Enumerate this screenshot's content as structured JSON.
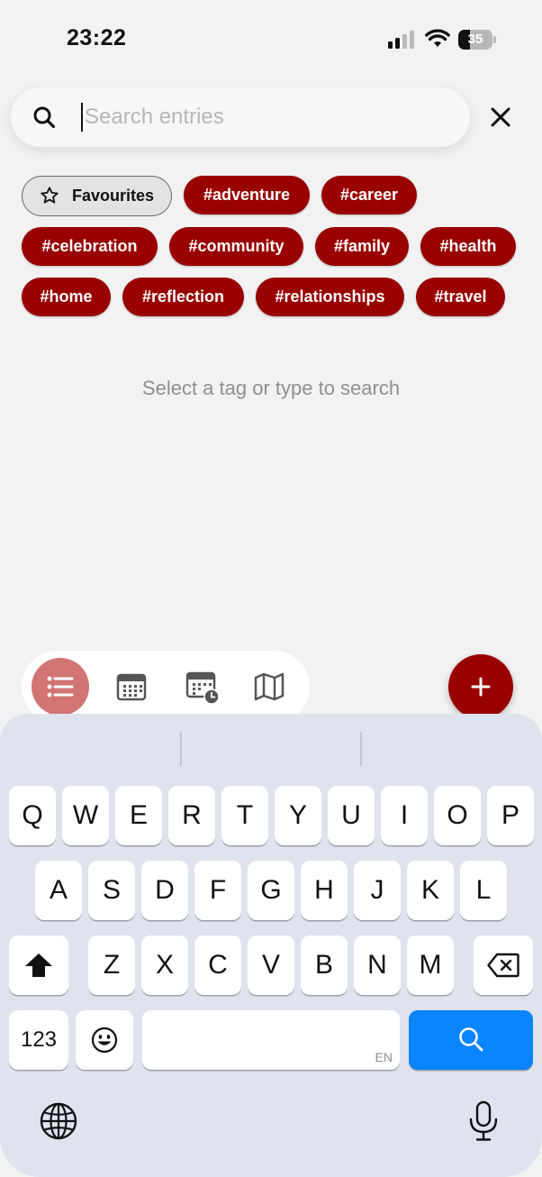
{
  "status_bar": {
    "time": "23:22",
    "battery": "35",
    "battery_level": 0.35,
    "signal_bars_active": 2,
    "signal_bars_total": 4
  },
  "search": {
    "placeholder": "Search entries",
    "value": "",
    "icon": "search-icon",
    "clear_icon": "close-icon"
  },
  "filters": {
    "favourites_label": "Favourites",
    "favourites_icon": "star-outline-icon",
    "tags": [
      "#adventure",
      "#career",
      "#celebration",
      "#community",
      "#family",
      "#health",
      "#home",
      "#reflection",
      "#relationships",
      "#travel"
    ]
  },
  "empty_state": {
    "message": "Select a tag or type to search"
  },
  "bottom_nav": {
    "items": [
      {
        "icon": "list-icon",
        "active": true
      },
      {
        "icon": "calendar-icon",
        "active": false
      },
      {
        "icon": "calendar-clock-icon",
        "active": false
      },
      {
        "icon": "map-icon",
        "active": false
      }
    ],
    "fab_icon": "plus-icon"
  },
  "keyboard": {
    "row1": [
      "Q",
      "W",
      "E",
      "R",
      "T",
      "Y",
      "U",
      "I",
      "O",
      "P"
    ],
    "row2": [
      "A",
      "S",
      "D",
      "F",
      "G",
      "H",
      "J",
      "K",
      "L"
    ],
    "row3": [
      "Z",
      "X",
      "C",
      "V",
      "B",
      "N",
      "M"
    ],
    "numbers_label": "123",
    "language_label": "EN",
    "shift_icon": "shift-icon",
    "delete_icon": "backspace-icon",
    "emoji_icon": "emoji-icon",
    "search_icon": "search-icon",
    "globe_icon": "globe-icon",
    "mic_icon": "microphone-icon"
  },
  "colors": {
    "accent": "#990000",
    "active_tab": "#d27474",
    "keyboard_bg": "#dfe3ee",
    "search_key": "#0a84ff",
    "background": "#f2f2f3"
  }
}
